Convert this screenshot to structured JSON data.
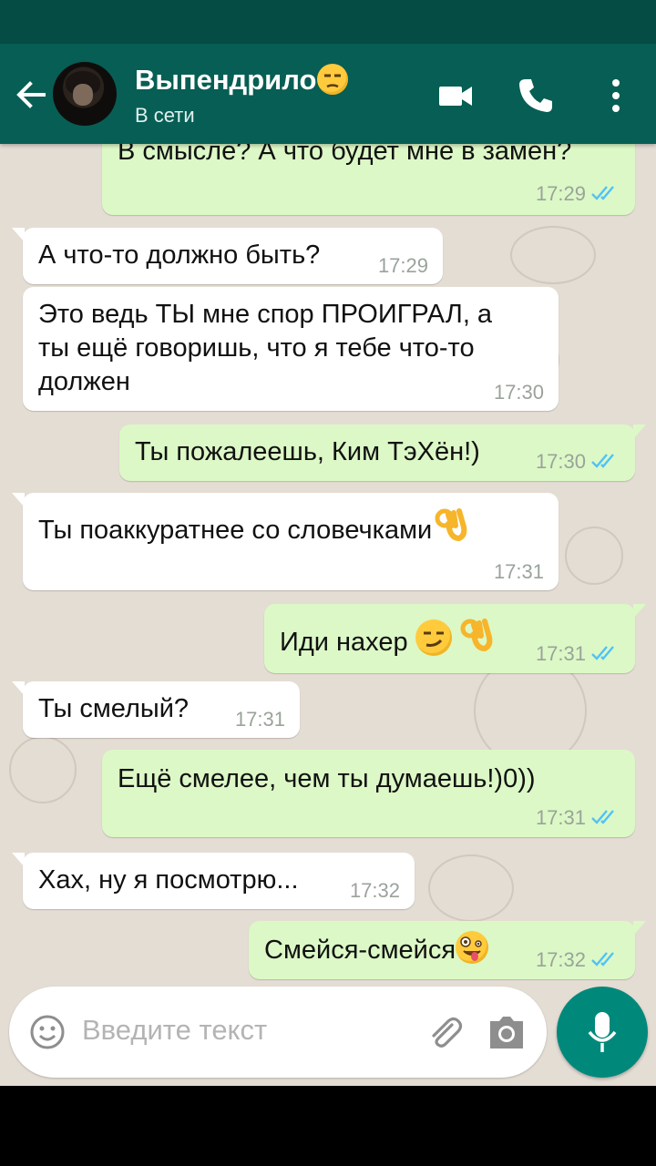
{
  "header": {
    "contact_name": "Выпендрило",
    "contact_status": "В сети"
  },
  "colors": {
    "app_bar": "#075e54",
    "status_bar": "#054d44",
    "incoming_bubble": "#ffffff",
    "outgoing_bubble": "#dcf8c6",
    "read_ticks": "#4fc3f7",
    "accent": "#00897b"
  },
  "messages": [
    {
      "direction": "out",
      "text": "В смысле? А что будет мне в замен?",
      "time": "17:29",
      "read": true
    },
    {
      "direction": "in",
      "text": "А что-то должно быть?",
      "time": "17:29"
    },
    {
      "direction": "in",
      "text_lines": [
        "Это ведь ТЫ мне спор ПРОИГРАЛ, а",
        "ты ещё говоришь, что я тебе что-то",
        "должен"
      ],
      "time": "17:30"
    },
    {
      "direction": "out",
      "text": "Ты пожалеешь, Ким ТэХён!)",
      "time": "17:30",
      "read": true
    },
    {
      "direction": "in",
      "text": "Ты поаккуратнее со словечками",
      "emoji": [
        "ok-hand-icon"
      ],
      "time": "17:31"
    },
    {
      "direction": "out",
      "text": "Иди нахер ",
      "emoji": [
        "smirk-icon",
        "ok-hand-icon"
      ],
      "time": "17:31",
      "read": true
    },
    {
      "direction": "in",
      "text": "Ты смелый?",
      "time": "17:31"
    },
    {
      "direction": "out",
      "text": "Ещё смелее, чем ты думаешь!)0))",
      "time": "17:31",
      "read": true
    },
    {
      "direction": "in",
      "text": "Хах, ну я посмотрю...",
      "time": "17:32"
    },
    {
      "direction": "out",
      "text": "Смейся-смейся",
      "emoji": [
        "zany-face-icon"
      ],
      "time": "17:32",
      "read": true
    }
  ],
  "composer": {
    "placeholder": "Введите текст"
  }
}
